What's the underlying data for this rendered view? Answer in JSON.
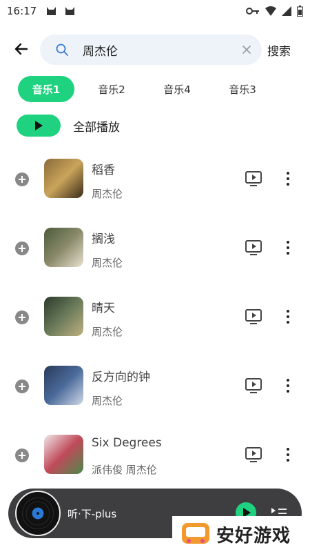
{
  "status_bar": {
    "time": "16:17"
  },
  "search": {
    "query": "周杰伦",
    "submit_label": "搜索"
  },
  "tabs": [
    {
      "label": "音乐1",
      "active": true
    },
    {
      "label": "音乐2",
      "active": false
    },
    {
      "label": "音乐4",
      "active": false
    },
    {
      "label": "音乐3",
      "active": false
    }
  ],
  "play_all": {
    "label": "全部播放"
  },
  "songs": [
    {
      "title": "稻香",
      "artist": "周杰伦",
      "cover_colors": [
        "#8a6a3a",
        "#c9a45a",
        "#3a2a1a"
      ]
    },
    {
      "title": "搁浅",
      "artist": "周杰伦",
      "cover_colors": [
        "#4a5a3a",
        "#8a8a6a",
        "#e8e0d0"
      ]
    },
    {
      "title": "晴天",
      "artist": "周杰伦",
      "cover_colors": [
        "#2a3a2a",
        "#6a7a5a",
        "#c0b080"
      ]
    },
    {
      "title": "反方向的钟",
      "artist": "周杰伦",
      "cover_colors": [
        "#2a3a5a",
        "#4a6a9a",
        "#d0d8e8"
      ]
    },
    {
      "title": "Six Degrees",
      "artist": "派伟俊 周杰伦",
      "cover_colors": [
        "#f0e8e8",
        "#c04a5a",
        "#4a8a4a"
      ]
    }
  ],
  "mini_player": {
    "title": "听·下-plus"
  },
  "watermark": {
    "text": "安好游戏"
  },
  "colors": {
    "accent": "#1fd27f",
    "player_bg": "#3e3e40"
  }
}
